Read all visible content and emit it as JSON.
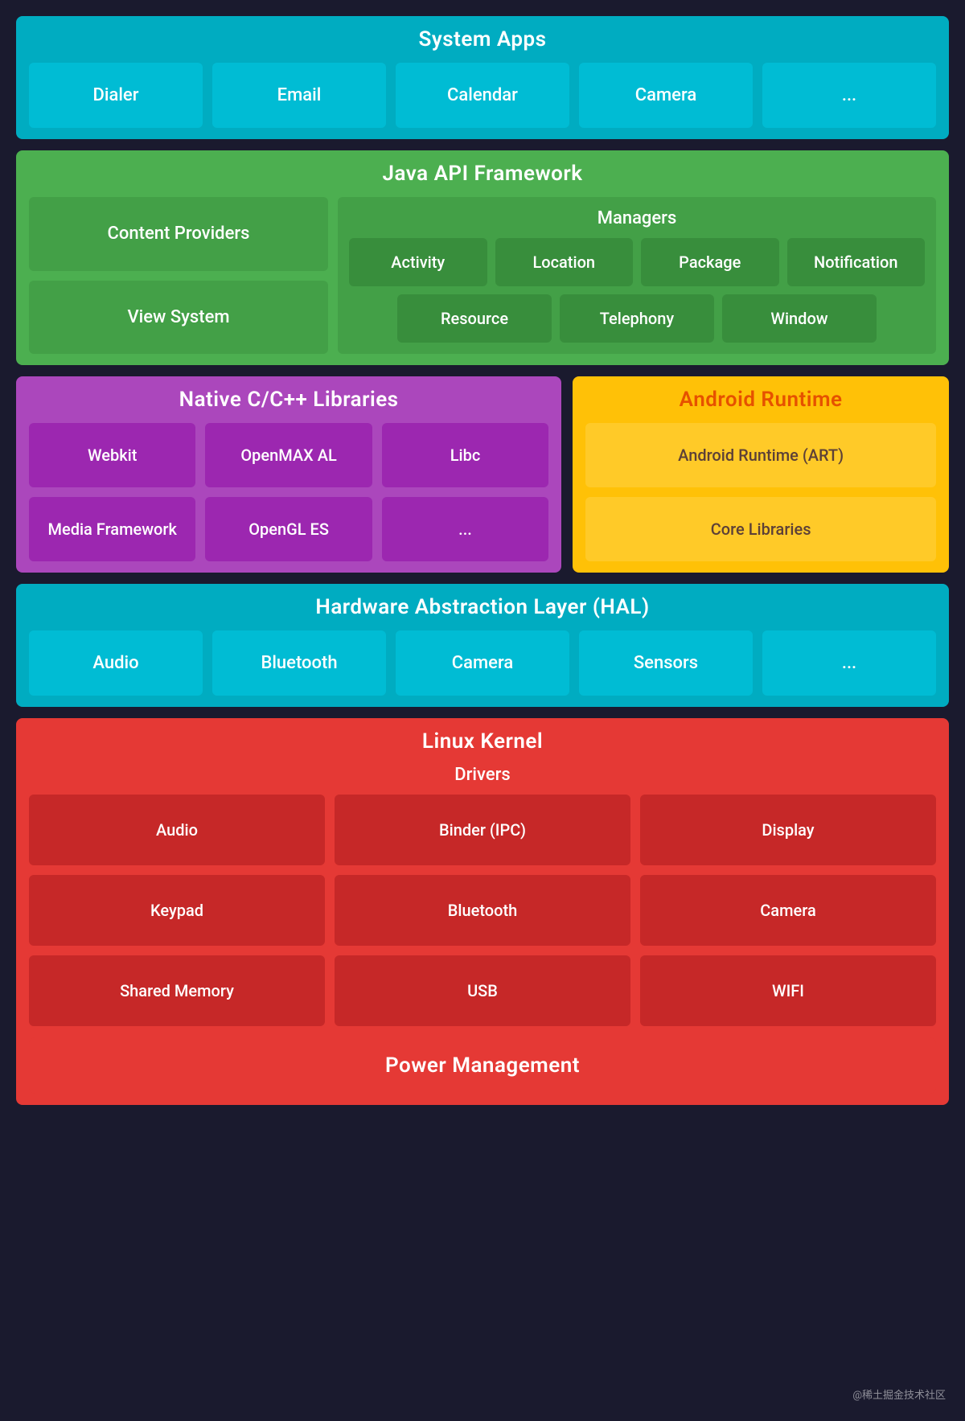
{
  "systemApps": {
    "title": "System Apps",
    "items": [
      "Dialer",
      "Email",
      "Calendar",
      "Camera",
      "..."
    ]
  },
  "javaAPI": {
    "title": "Java API Framework",
    "leftItems": [
      "Content Providers",
      "View System"
    ],
    "managers": {
      "title": "Managers",
      "row1": [
        "Activity",
        "Location",
        "Package",
        "Notification"
      ],
      "row2": [
        "Resource",
        "Telephony",
        "Window"
      ]
    }
  },
  "nativeCpp": {
    "title": "Native C/C++ Libraries",
    "row1": [
      "Webkit",
      "OpenMAX AL",
      "Libc"
    ],
    "row2": [
      "Media Framework",
      "OpenGL ES",
      "..."
    ]
  },
  "androidRuntime": {
    "title": "Android Runtime",
    "items": [
      "Android Runtime (ART)",
      "Core Libraries"
    ]
  },
  "hal": {
    "title": "Hardware Abstraction Layer (HAL)",
    "items": [
      "Audio",
      "Bluetooth",
      "Camera",
      "Sensors",
      "..."
    ]
  },
  "linuxKernel": {
    "title": "Linux Kernel",
    "drivers": {
      "label": "Drivers",
      "row1": [
        "Audio",
        "Binder (IPC)",
        "Display"
      ],
      "row2": [
        "Keypad",
        "Bluetooth",
        "Camera"
      ],
      "row3": [
        "Shared Memory",
        "USB",
        "WIFI"
      ]
    }
  },
  "powerManagement": {
    "title": "Power Management"
  },
  "watermark": "@稀土掘金技术社区"
}
